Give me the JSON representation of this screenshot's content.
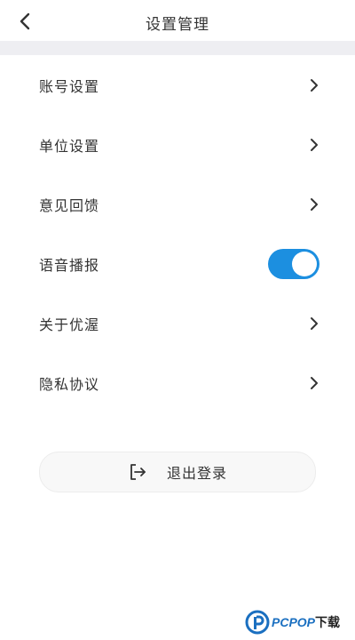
{
  "header": {
    "title": "设置管理",
    "back_icon": "chevron-left-icon"
  },
  "settings": {
    "items": [
      {
        "label": "账号设置",
        "control": "chevron"
      },
      {
        "label": "单位设置",
        "control": "chevron"
      },
      {
        "label": "意见回馈",
        "control": "chevron"
      },
      {
        "label": "语音播报",
        "control": "toggle",
        "toggle_on": true
      },
      {
        "label": "关于优渥",
        "control": "chevron"
      },
      {
        "label": "隐私协议",
        "control": "chevron"
      }
    ]
  },
  "logout": {
    "label": "退出登录",
    "icon": "logout-icon"
  },
  "watermark": {
    "text": "PCPOP",
    "text_cn": "下载"
  },
  "colors": {
    "accent": "#1c8fe0",
    "divider": "#eeeef2",
    "watermark_blue": "#1a6fc0"
  }
}
